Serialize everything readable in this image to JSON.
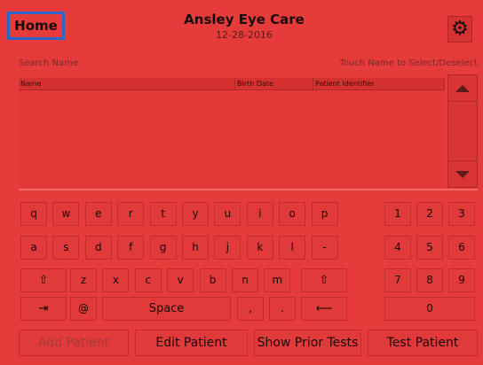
{
  "header": {
    "home_label": "Home",
    "title": "Ansley Eye Care",
    "date": "12-28-2016",
    "settings_icon": "gear-icon"
  },
  "search": {
    "label": "Search Name",
    "hint": "Touch Name to Select/Deselect"
  },
  "table": {
    "columns": [
      "Name",
      "Birth Date",
      "Patient Identifier"
    ],
    "rows": []
  },
  "keyboard": {
    "row1": [
      "q",
      "w",
      "e",
      "r",
      "t",
      "y",
      "u",
      "i",
      "o",
      "p"
    ],
    "row2": [
      "a",
      "s",
      "d",
      "f",
      "g",
      "h",
      "j",
      "k",
      "l",
      "-"
    ],
    "row3": [
      "z",
      "x",
      "c",
      "v",
      "b",
      "n",
      "m"
    ],
    "shift_glyph": "⇧",
    "tab_glyph": "⇥",
    "at_label": "@",
    "space_label": "Space",
    "comma_label": ",",
    "period_label": ".",
    "backspace_glyph": "⟵",
    "numpad": [
      "1",
      "2",
      "3",
      "4",
      "5",
      "6",
      "7",
      "8",
      "9",
      "0"
    ]
  },
  "actions": {
    "add_patient": "Add Patient",
    "edit_patient": "Edit Patient",
    "show_prior_tests": "Show Prior Tests",
    "test_patient": "Test Patient"
  },
  "colors": {
    "background": "#e63b3b",
    "home_border": "#2a67c8"
  }
}
